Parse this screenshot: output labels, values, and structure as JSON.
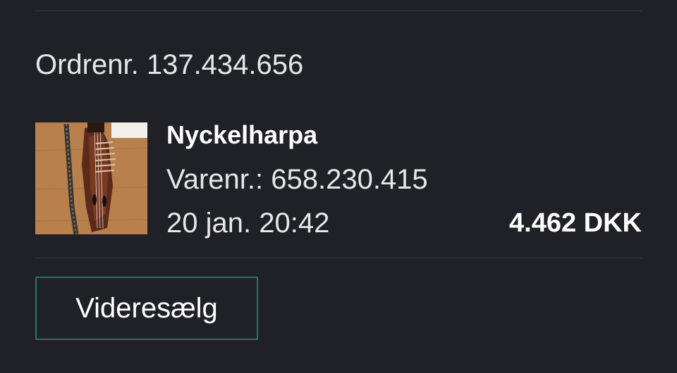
{
  "order": {
    "number_label": "Ordrenr. 137.434.656"
  },
  "item": {
    "image_icon": "nyckelharpa-instrument-photo",
    "title": "Nyckelharpa",
    "item_number": "Varenr.: 658.230.415",
    "date": "20 jan. 20:42",
    "price": "4.462 DKK"
  },
  "actions": {
    "resell_label": "Videresælg"
  },
  "colors": {
    "background": "#202027",
    "text_primary": "#ffffff",
    "text_secondary": "#e7e7ea",
    "divider": "#3a3a42",
    "button_border": "#1e7a5e"
  }
}
